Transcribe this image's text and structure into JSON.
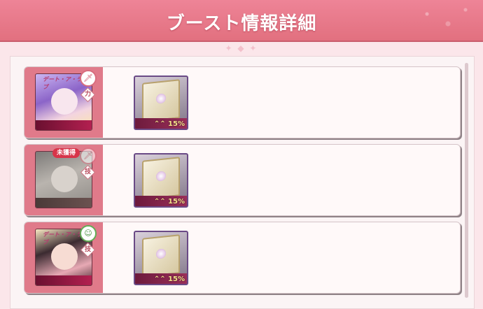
{
  "header": {
    "title": "ブースト情報詳細",
    "decoration": "✦ ◆ ✦"
  },
  "rows": [
    {
      "character": {
        "stamp": "デート・ア・ライブ",
        "badge_top": "🗡",
        "badge_level": "力"
      },
      "item": {
        "boost": "⌃⌃ 15%"
      }
    },
    {
      "character": {
        "status": "未獲得",
        "stamp": "",
        "badge_top": "🗡",
        "badge_level": "技"
      },
      "item": {
        "boost": "⌃⌃ 15%"
      }
    },
    {
      "character": {
        "stamp": "デート・ア・ライブ",
        "badge_top": "☺",
        "badge_level": "技"
      },
      "item": {
        "boost": "⌃⌃ 15%"
      }
    }
  ],
  "colors": {
    "accent": "#e2707f",
    "row_side": "#e07a8a",
    "unowned_badge": "#d7354a"
  }
}
